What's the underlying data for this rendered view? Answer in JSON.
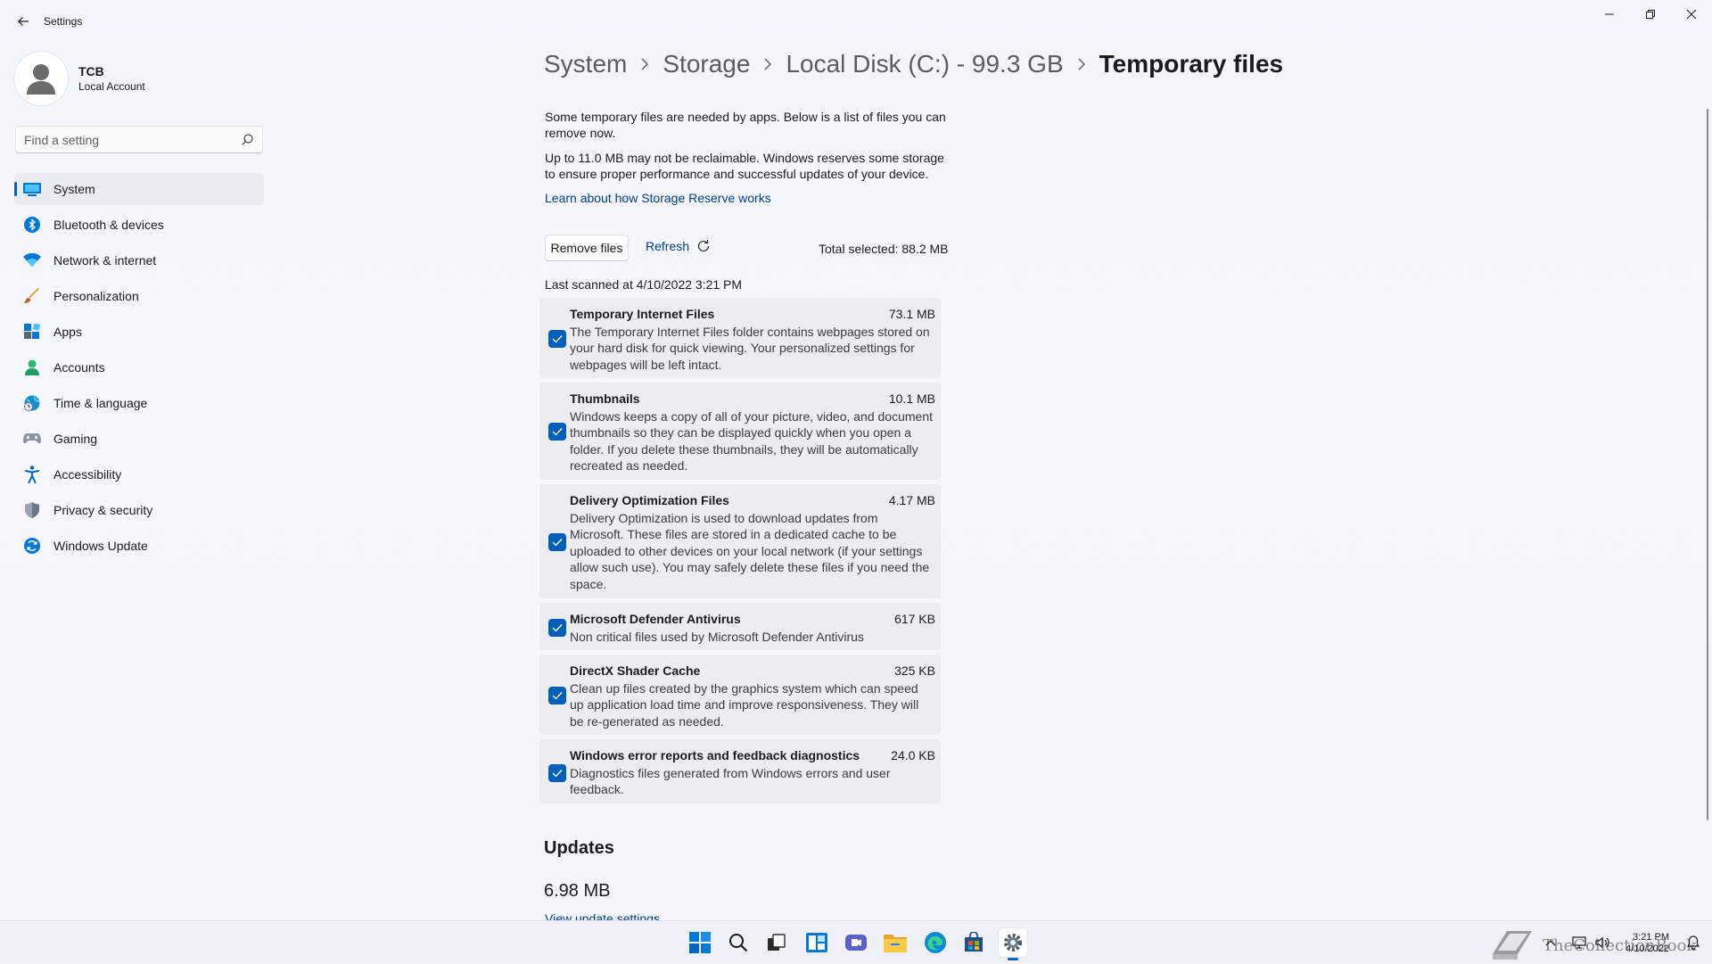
{
  "window": {
    "title": "Settings"
  },
  "profile": {
    "name": "TCB",
    "account_type": "Local Account"
  },
  "search": {
    "placeholder": "Find a setting"
  },
  "nav": {
    "items": [
      {
        "label": "System",
        "icon": "system-icon",
        "active": true
      },
      {
        "label": "Bluetooth & devices",
        "icon": "bluetooth-icon"
      },
      {
        "label": "Network & internet",
        "icon": "wifi-icon"
      },
      {
        "label": "Personalization",
        "icon": "brush-icon"
      },
      {
        "label": "Apps",
        "icon": "apps-icon"
      },
      {
        "label": "Accounts",
        "icon": "person-icon"
      },
      {
        "label": "Time & language",
        "icon": "globe-clock-icon"
      },
      {
        "label": "Gaming",
        "icon": "gamepad-icon"
      },
      {
        "label": "Accessibility",
        "icon": "accessibility-icon"
      },
      {
        "label": "Privacy & security",
        "icon": "shield-icon"
      },
      {
        "label": "Windows Update",
        "icon": "update-icon"
      }
    ]
  },
  "breadcrumb": {
    "items": [
      "System",
      "Storage",
      "Local Disk (C:) - 99.3 GB"
    ],
    "current": "Temporary files"
  },
  "content": {
    "intro": "Some temporary files are needed by apps. Below is a list of files you can remove now.",
    "reserve_note": "Up to 11.0 MB may not be reclaimable. Windows reserves some storage to ensure proper performance and successful updates of your device.",
    "learn_link": "Learn about how Storage Reserve works",
    "remove_button": "Remove files",
    "refresh_button": "Refresh",
    "total_selected": "Total selected: 88.2 MB",
    "last_scanned": "Last scanned at 4/10/2022 3:21 PM"
  },
  "file_items": [
    {
      "title": "Temporary Internet Files",
      "size": "73.1 MB",
      "checked": true,
      "description": "The Temporary Internet Files folder contains webpages stored on your hard disk for quick viewing. Your personalized settings for webpages will be left intact."
    },
    {
      "title": "Thumbnails",
      "size": "10.1 MB",
      "checked": true,
      "description": "Windows keeps a copy of all of your picture, video, and document thumbnails so they can be displayed quickly when you open a folder. If you delete these thumbnails, they will be automatically recreated as needed."
    },
    {
      "title": "Delivery Optimization Files",
      "size": "4.17 MB",
      "checked": true,
      "description": "Delivery Optimization is used to download updates from Microsoft. These files are stored in a dedicated cache to be uploaded to other devices on your local network (if your settings allow such use). You may safely delete these files if you need the space."
    },
    {
      "title": "Microsoft Defender Antivirus",
      "size": "617 KB",
      "checked": true,
      "description": "Non critical files used by Microsoft Defender Antivirus"
    },
    {
      "title": "DirectX Shader Cache",
      "size": "325 KB",
      "checked": true,
      "description": "Clean up files created by the graphics system which can speed up application load time and improve responsiveness. They will be re-generated as needed."
    },
    {
      "title": "Windows error reports and feedback diagnostics",
      "size": "24.0 KB",
      "checked": true,
      "description": "Diagnostics files generated from Windows errors and user feedback."
    }
  ],
  "updates": {
    "heading": "Updates",
    "size": "6.98 MB",
    "link": "View update settings"
  },
  "taskbar": {
    "apps": [
      "start-icon",
      "search-icon",
      "task-view-icon",
      "widgets-icon",
      "chat-icon",
      "file-explorer-icon",
      "edge-icon",
      "store-icon",
      "settings-icon"
    ],
    "time": "3:21 PM",
    "date": "4/10/2022"
  },
  "watermark": {
    "text": "TheCollectionBook"
  },
  "colors": {
    "accent": "#005fb8",
    "link": "#003e92",
    "card": "#ebedf1"
  }
}
